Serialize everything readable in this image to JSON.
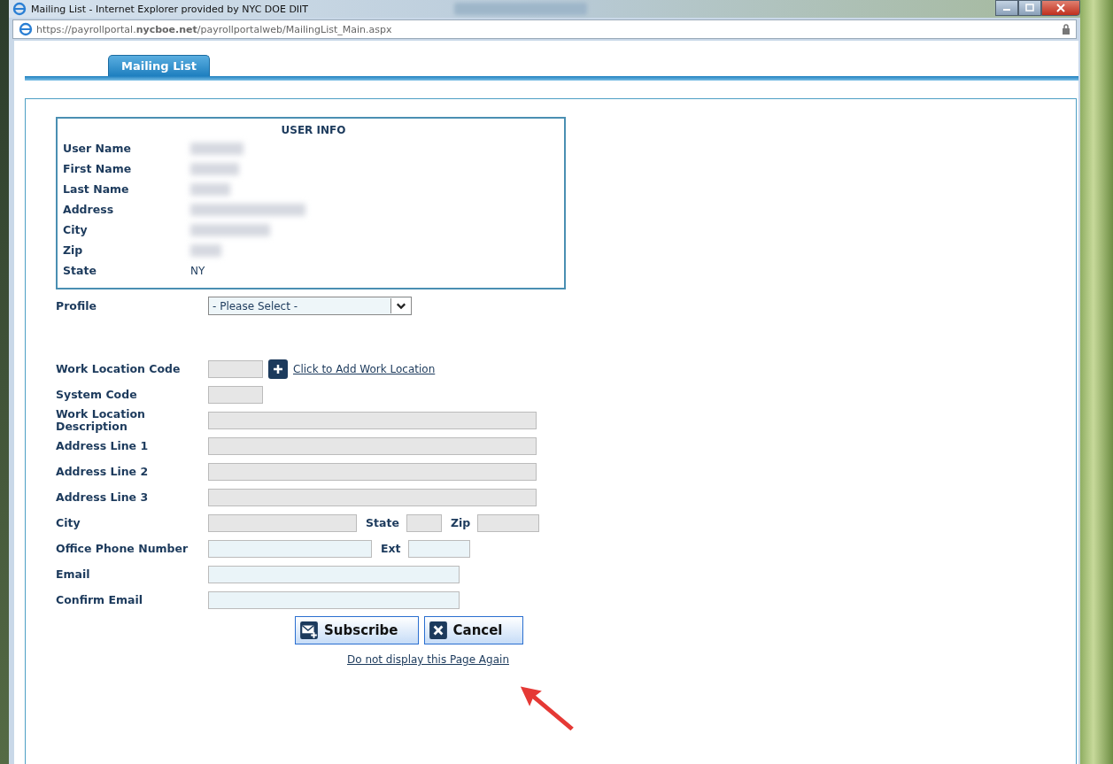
{
  "window": {
    "title": "Mailing List - Internet Explorer provided by NYC DOE DIIT",
    "url": "https://payrollportal.**nycboe.net**/payrollportalweb/MailingList_Main.aspx"
  },
  "tabs": [
    {
      "label": "Mailing List",
      "selected": true
    }
  ],
  "user_info": {
    "title": "USER INFO",
    "rows": [
      {
        "label": "User Name",
        "kind": "blurred"
      },
      {
        "label": "First Name",
        "kind": "blurred"
      },
      {
        "label": "Last Name",
        "kind": "blurred"
      },
      {
        "label": "Address",
        "kind": "blurred"
      },
      {
        "label": "City",
        "kind": "blurred"
      },
      {
        "label": "Zip",
        "kind": "blurred"
      },
      {
        "label": "State",
        "kind": "text",
        "value": "NY"
      }
    ]
  },
  "profile": {
    "label": "Profile",
    "value": "- Please Select -"
  },
  "form_rows": [
    {
      "label": "Work Location Code",
      "fields": [
        {
          "kind": "small",
          "disabled": true
        }
      ],
      "link": "Click to Add Work Location"
    },
    {
      "label": "System Code",
      "fields": [
        {
          "kind": "small",
          "disabled": true
        }
      ]
    },
    {
      "label": "Work Location Description",
      "fields": [
        {
          "kind": "full",
          "disabled": true
        }
      ]
    },
    {
      "label": "Address Line 1",
      "fields": [
        {
          "kind": "full",
          "disabled": true
        }
      ]
    },
    {
      "label": "Address Line 2",
      "fields": [
        {
          "kind": "full",
          "disabled": true
        }
      ]
    },
    {
      "label": "Address Line 3",
      "fields": [
        {
          "kind": "full",
          "disabled": true
        }
      ]
    },
    {
      "label": "City",
      "fields": [
        {
          "kind": "city",
          "disabled": true
        },
        {
          "label": "State",
          "kind": "tiny",
          "disabled": true
        },
        {
          "label": "Zip",
          "kind": "zip",
          "disabled": true
        }
      ]
    },
    {
      "label": "Office Phone Number",
      "fields": [
        {
          "kind": "phone",
          "disabled": false
        },
        {
          "label": "Ext",
          "kind": "zip",
          "disabled": false
        }
      ]
    },
    {
      "label": "Email",
      "fields": [
        {
          "kind": "email",
          "disabled": false
        }
      ]
    },
    {
      "label": "Confirm Email",
      "fields": [
        {
          "kind": "email",
          "disabled": false
        }
      ]
    }
  ],
  "buttons": [
    {
      "label": "Subscribe",
      "kind": "subscribe"
    },
    {
      "label": "Cancel",
      "kind": "cancel"
    }
  ],
  "footer_link": "Do not display this Page Again"
}
